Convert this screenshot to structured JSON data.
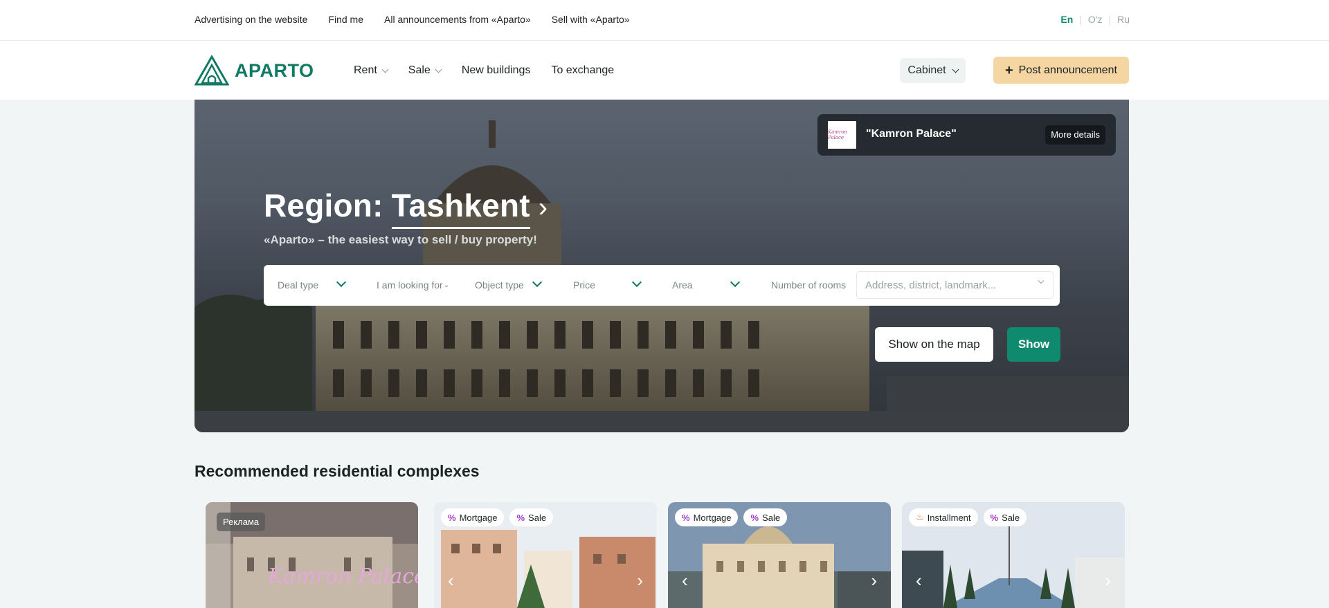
{
  "topbar": {
    "links": [
      "Advertising on the website",
      "Find me",
      "All announcements from «Aparto»",
      "Sell with «Aparto»"
    ],
    "languages": [
      "En",
      "O'z",
      "Ru"
    ],
    "active_language": "En"
  },
  "header": {
    "logo": "APARTO",
    "nav": [
      {
        "label": "Rent",
        "dropdown": true
      },
      {
        "label": "Sale",
        "dropdown": true
      },
      {
        "label": "New buildings",
        "dropdown": false
      },
      {
        "label": "To exchange",
        "dropdown": false
      }
    ],
    "cabinet": "Cabinet",
    "post_button": "Post announcement"
  },
  "hero": {
    "promo": {
      "name": "\"Kamron Palace\"",
      "button": "More details",
      "thumb_text": "Kamron Palace"
    },
    "region_label": "Region:",
    "region_value": "Tashkent",
    "subtitle": "«Aparto» – the easiest way to sell / buy property!",
    "filters": {
      "deal_type": "Deal type",
      "looking_for": "I am looking for",
      "object_type": "Object type",
      "price": "Price",
      "area": "Area",
      "rooms": "Number of rooms",
      "address_placeholder": "Address, district, landmark..."
    },
    "map_button": "Show on the map",
    "show_button": "Show"
  },
  "recommended": {
    "title": "Recommended residential complexes",
    "cards": [
      {
        "badge": "Реклама",
        "tags": [],
        "overlay_text": "Kamron Palace"
      },
      {
        "tags": [
          {
            "icon": "percent-icon",
            "label": "Mortgage"
          },
          {
            "icon": "percent-icon",
            "label": "Sale"
          }
        ]
      },
      {
        "tags": [
          {
            "icon": "percent-icon",
            "label": "Mortgage"
          },
          {
            "icon": "percent-icon",
            "label": "Sale"
          }
        ]
      },
      {
        "tags": [
          {
            "icon": "fire-icon",
            "label": "Installment"
          },
          {
            "icon": "percent-icon",
            "label": "Sale"
          }
        ]
      }
    ]
  },
  "colors": {
    "brand_green": "#0f8a6e",
    "post_button": "#f5d5a2",
    "background": "#f2f5f5"
  }
}
